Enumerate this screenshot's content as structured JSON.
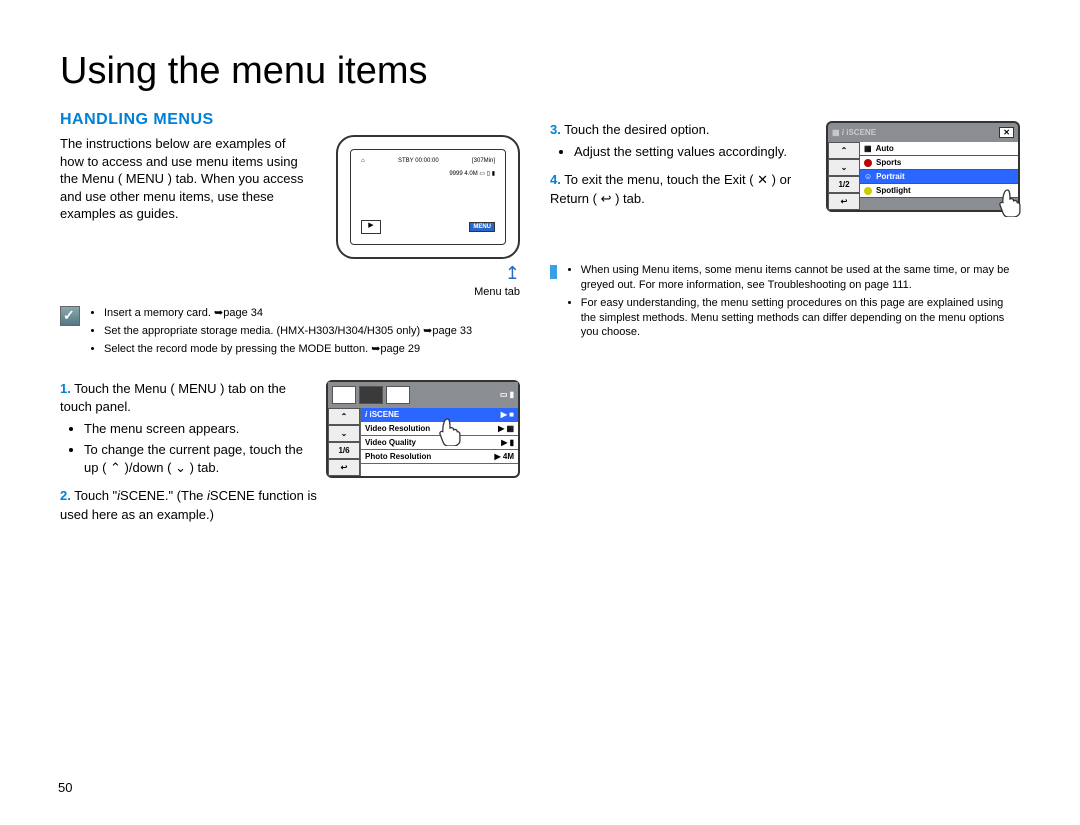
{
  "title": "Using the menu items",
  "heading": "HANDLING MENUS",
  "intro": "The instructions below are examples of how to access and use menu items using the Menu ( MENU ) tab. When you access and use other menu items, use these examples as guides.",
  "fig1_caption": "Menu tab",
  "pre_notes": [
    "Insert a memory card. ➥page 34",
    "Set the appropriate storage media. (HMX-H303/H304/H305 only) ➥page 33",
    "Select the record mode by pressing the MODE button. ➥page 29"
  ],
  "step1": {
    "num": "1.",
    "text": "Touch the Menu ( MENU ) tab on the touch panel.",
    "subs": [
      "The menu screen appears.",
      "To change the current page, touch the up ( ⌃ )/down ( ⌄ ) tab."
    ]
  },
  "step2": {
    "num": "2.",
    "text_a": "Touch \"",
    "scene_label": "SCENE.",
    "text_b": "\" (The ",
    "scene_label2": "SCENE",
    "text_c": " function is used here as an example.)"
  },
  "step3": {
    "num": "3.",
    "text": "Touch the desired option.",
    "subs": [
      "Adjust the setting values accordingly."
    ]
  },
  "step4": {
    "num": "4.",
    "text": "To exit the menu, touch the Exit ( ✕ ) or Return ( ↩ ) tab."
  },
  "info_notes": [
    "When using Menu items, some menu items cannot be used at the same time, or may be greyed out. For more information, see Troubleshooting on page 111.",
    "For easy understanding, the menu setting procedures on this page are explained using the simplest methods. Menu setting methods can differ depending on the menu options you choose."
  ],
  "device": {
    "status_left": "STBY",
    "status_time": "00:00:00",
    "status_right": "[307Min]",
    "counter": "9999",
    "size": "4.0M",
    "menu_btn": "MENU"
  },
  "menu_screen": {
    "nav": [
      "⌃",
      "⌄",
      "1/6",
      "↩"
    ],
    "rows": [
      {
        "label": "iSCENE",
        "right": "▶ ■",
        "hl": true
      },
      {
        "label": "Video Resolution",
        "right": "▶ ▦",
        "hl": false
      },
      {
        "label": "Video Quality",
        "right": "▶ ▮",
        "hl": false
      },
      {
        "label": "Photo Resolution",
        "right": "▶ 4M",
        "hl": false
      }
    ]
  },
  "scene_menu": {
    "title": "iSCENE",
    "close": "✕",
    "nav": [
      "⌃",
      "⌄",
      "1/2",
      "↩"
    ],
    "rows": [
      {
        "label": "Auto",
        "sel": false
      },
      {
        "label": "Sports",
        "sel": false
      },
      {
        "label": "Portrait",
        "sel": true
      },
      {
        "label": "Spotlight",
        "sel": false
      }
    ]
  },
  "page_number": "50"
}
